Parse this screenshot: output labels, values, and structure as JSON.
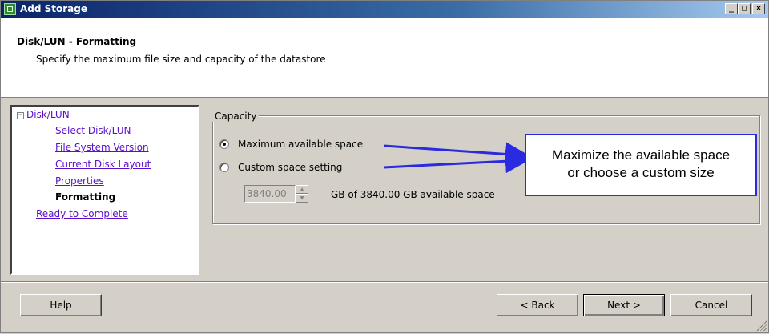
{
  "window": {
    "title": "Add Storage",
    "controls": {
      "minimize": "_",
      "maximize": "□",
      "close": "×"
    }
  },
  "header": {
    "title": "Disk/LUN - Formatting",
    "subtitle": "Specify the maximum file size and capacity of the datastore"
  },
  "nav": {
    "toggle": "−",
    "items": [
      {
        "label": "Disk/LUN",
        "state": "link"
      },
      {
        "label": "Select Disk/LUN",
        "state": "link"
      },
      {
        "label": "File System Version",
        "state": "link"
      },
      {
        "label": "Current Disk Layout",
        "state": "link"
      },
      {
        "label": "Properties",
        "state": "link"
      },
      {
        "label": "Formatting",
        "state": "current"
      },
      {
        "label": "Ready to Complete",
        "state": "link"
      }
    ],
    "link_color": "#5b0fc9"
  },
  "capacity": {
    "legend": "Capacity",
    "options": [
      {
        "label": "Maximum available space",
        "checked": true
      },
      {
        "label": "Custom space setting",
        "checked": false
      }
    ],
    "size_value": "3840.00",
    "size_caption": "GB of 3840.00 GB available space"
  },
  "callout": {
    "lines": [
      "Maximize the available space",
      "or choose a custom size"
    ],
    "color": "#2a2ae0"
  },
  "footer": {
    "help": "Help",
    "back": "< Back",
    "next": "Next >",
    "cancel": "Cancel"
  },
  "icons": {
    "app": "app-icon",
    "spin_up": "spin-up-icon",
    "spin_down": "spin-down-icon",
    "grip": "resize-grip-icon"
  }
}
